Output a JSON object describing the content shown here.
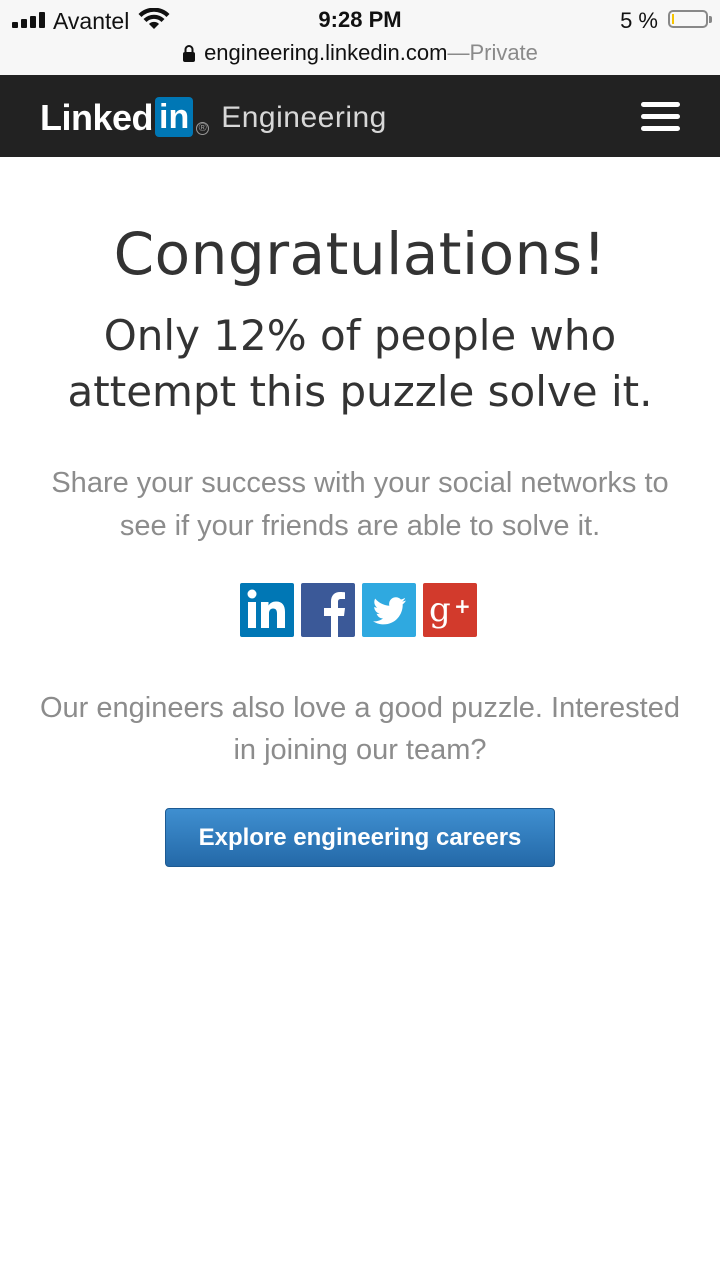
{
  "status_bar": {
    "carrier": "Avantel",
    "time": "9:28 PM",
    "battery_percent": "5 %",
    "battery_level": 0.05
  },
  "browser": {
    "domain": "engineering.linkedin.com",
    "separator": " — ",
    "mode": "Private"
  },
  "header": {
    "logo_linked": "Linked",
    "logo_in": "in",
    "logo_reg": "®",
    "section": "Engineering",
    "menu_icon": "hamburger-menu-icon"
  },
  "main": {
    "title": "Congratulations!",
    "subtitle": "Only 12% of people who attempt this puzzle solve it.",
    "share_text": "Share your success with your social networks to see if your friends are able to solve it.",
    "social": [
      {
        "name": "linkedin",
        "icon": "linkedin-icon",
        "color": "#0077b5"
      },
      {
        "name": "facebook",
        "icon": "facebook-icon",
        "color": "#3b5998"
      },
      {
        "name": "twitter",
        "icon": "twitter-icon",
        "color": "#2fa9e0"
      },
      {
        "name": "google-plus",
        "icon": "google-plus-icon",
        "color": "#d23a2c"
      }
    ],
    "join_text": "Our engineers also love a good puzzle. Interested in joining our team?",
    "cta_label": "Explore engineering careers"
  },
  "colors": {
    "header_bg": "#222222",
    "cta_blue": "#2a75b8",
    "muted_text": "#8c8c8c"
  }
}
